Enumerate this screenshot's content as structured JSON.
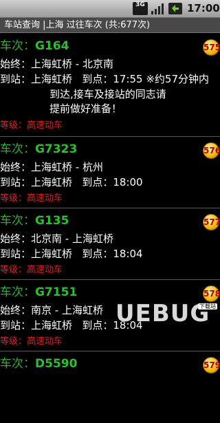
{
  "statusbar": {
    "network": "3G",
    "time": "17:00"
  },
  "title": "车站查询 |上海 过往车次 (共:677次)",
  "labels": {
    "train": "车次：",
    "route": "始终：",
    "arrival": "到站：",
    "arrive_at": "到点："
  },
  "trains": [
    {
      "number": "G164",
      "route": "上海虹桥 - 北京南",
      "station": "上海虹桥",
      "time": "17:55",
      "note_first": " ※约57分钟内",
      "note_rest": "到达,接车及接站的同志请\n提前做好准备！",
      "grade": "等级：高速动车",
      "badge": "575"
    },
    {
      "number": "G7323",
      "route": "上海虹桥 - 杭州",
      "station": "上海虹桥",
      "time": "18:00",
      "grade": "等级：高速动车",
      "badge": "576"
    },
    {
      "number": "G135",
      "route": "北京南 - 上海虹桥",
      "station": "上海虹桥",
      "time": "18:04",
      "grade": "等级：高速动车",
      "badge": "577"
    },
    {
      "number": "G7151",
      "route": "南京 - 上海虹桥",
      "station": "上海虹桥",
      "time": "18:04",
      "grade": "等级：高速动车",
      "badge": "578"
    },
    {
      "number": "D5590",
      "badge": "579"
    }
  ],
  "watermark": {
    "text": "UEBUG",
    "tag": "下载站"
  }
}
